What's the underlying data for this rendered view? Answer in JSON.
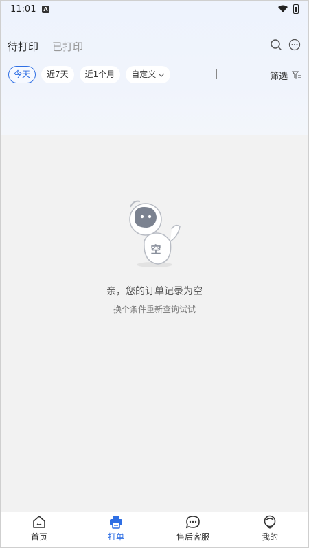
{
  "status_bar": {
    "time": "11:01",
    "a_glyph": "A"
  },
  "tabs": [
    {
      "label": "待打印",
      "active": true
    },
    {
      "label": "已打印",
      "active": false
    }
  ],
  "header_icons": [
    "search-icon",
    "more-icon"
  ],
  "filters": {
    "chips": [
      {
        "label": "今天",
        "active": true
      },
      {
        "label": "近7天",
        "active": false
      },
      {
        "label": "近1个月",
        "active": false
      },
      {
        "label": "自定义",
        "active": false,
        "has_dropdown": true
      }
    ],
    "filter_label": "筛选"
  },
  "empty_state": {
    "badge_text": "空",
    "title": "亲，您的订单记录为空",
    "subtitle": "换个条件重新查询试试"
  },
  "bottom_nav": [
    {
      "label": "首页",
      "icon": "home-icon",
      "active": false
    },
    {
      "label": "打单",
      "icon": "printer-icon",
      "active": true
    },
    {
      "label": "售后客服",
      "icon": "chat-icon",
      "active": false
    },
    {
      "label": "我的",
      "icon": "profile-icon",
      "active": false
    }
  ],
  "colors": {
    "accent": "#2f6fe4"
  }
}
